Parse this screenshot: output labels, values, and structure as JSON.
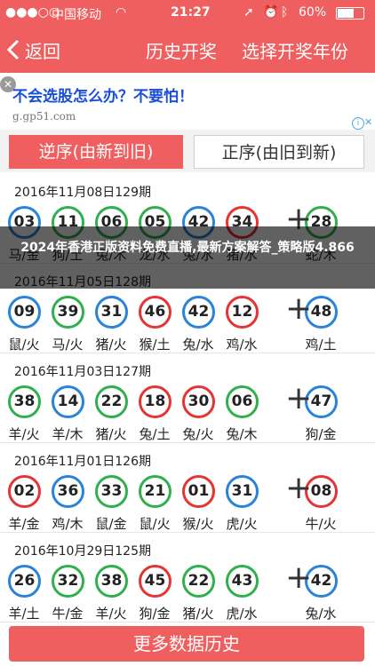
{
  "status_bar": {
    "carrier": "中国移动",
    "time": "21:27",
    "battery": "60%"
  },
  "nav": {
    "back_label": "返回",
    "title": "历史开奖",
    "right_action": "选择开奖年份"
  },
  "ad": {
    "text": "不会选股怎么办？不要怕！",
    "url": "g.gp51.com",
    "close_glyph": "✕"
  },
  "tabs": [
    {
      "label": "逆序(由新到旧)",
      "active": true
    },
    {
      "label": "正序(由旧到新)",
      "active": false
    }
  ],
  "draws": [
    {
      "title": "2016年11月08日129期",
      "numbers": [
        "03",
        "11",
        "06",
        "05",
        "42",
        "34",
        "28"
      ],
      "zodiac": [
        "马/金",
        "狗/土",
        "兔/木",
        "龙/水",
        "兔/水",
        "猪/水",
        "蛇/木"
      ]
    },
    {
      "title": "2016年11月05日128期",
      "numbers": [
        "09",
        "39",
        "31",
        "46",
        "42",
        "12",
        "48"
      ],
      "zodiac": [
        "鼠/火",
        "马/火",
        "猪/火",
        "猴/土",
        "兔/水",
        "鸡/水",
        "鸡/土"
      ]
    },
    {
      "title": "2016年11月03日127期",
      "numbers": [
        "38",
        "14",
        "22",
        "18",
        "30",
        "06",
        "47"
      ],
      "zodiac": [
        "羊/火",
        "羊/木",
        "猪/火",
        "兔/土",
        "兔/火",
        "兔/木",
        "狗/金"
      ]
    },
    {
      "title": "2016年11月01日126期",
      "numbers": [
        "02",
        "36",
        "33",
        "21",
        "01",
        "31",
        "08"
      ],
      "zodiac": [
        "羊/金",
        "鸡/木",
        "鼠/金",
        "鼠/火",
        "猴/火",
        "虎/火",
        "牛/火"
      ]
    },
    {
      "title": "2016年10月29日125期",
      "numbers": [
        "26",
        "32",
        "38",
        "45",
        "22",
        "43",
        "42"
      ],
      "zodiac": [
        "羊/土",
        "牛/金",
        "羊/火",
        "狗/金",
        "猪/火",
        "虎/水",
        "兔/水"
      ]
    }
  ],
  "overlay": {
    "text": "2024年香港正版资料免费直播,最新方案解答_策略版4.866"
  },
  "more_button": {
    "label": "更多数据历史"
  },
  "colors": {
    "red": "#e43434",
    "blue": "#2a83d8",
    "green": "#30b04d",
    "accent": "#ef5f5f"
  }
}
